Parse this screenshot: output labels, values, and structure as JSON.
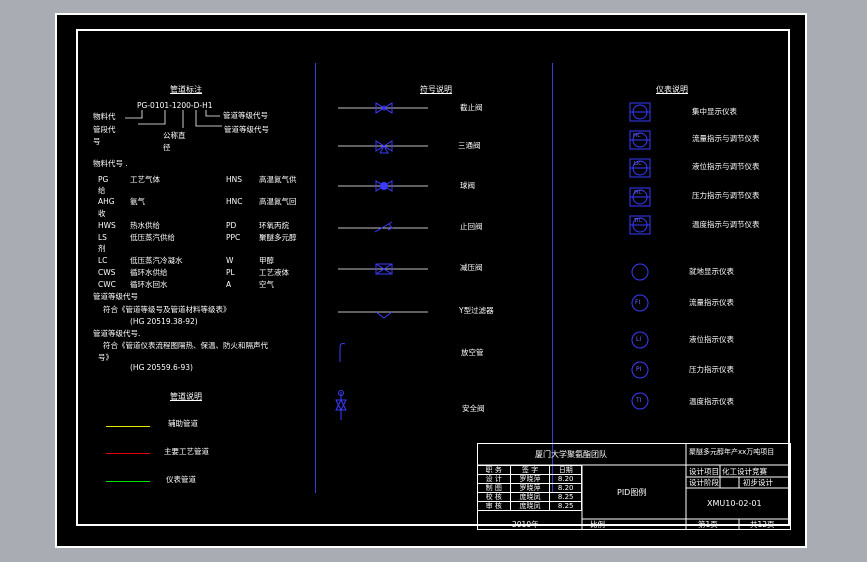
{
  "pipe_std": {
    "title": "管道标注",
    "code": "PG-0101-1200-D-H1",
    "lbl_material": "物料代",
    "lbl_grade": "管道等级代号",
    "lbl_segment": "管段代",
    "lbl_segment2": "号",
    "lbl_nominal": "公称直",
    "lbl_nominal2": "径",
    "lbl_grade2": "管道等级代号",
    "lbl_matcode": "物料代号 ."
  },
  "materials": [
    {
      "code": "PG",
      "name": "工艺气体"
    },
    {
      "code": "AHG",
      "name": "氨气"
    },
    {
      "code": "HWS",
      "name": "热水供给"
    },
    {
      "code": "LS",
      "name": "低压蒸汽供给"
    },
    {
      "code": "LC",
      "name": "低压蒸汽冷凝水"
    },
    {
      "code": "CWS",
      "name": "循环水供给"
    },
    {
      "code": "CWC",
      "name": "循环水回水"
    }
  ],
  "materials_right": [
    {
      "code": "HNS",
      "name": "高温氮气供"
    },
    {
      "code": "HNC",
      "name": "高温氮气回"
    },
    {
      "code": "PD",
      "name": "环氧丙烷"
    },
    {
      "code": "PPC",
      "name": "聚醚多元醇"
    },
    {
      "code": "W",
      "name": "甲醇"
    },
    {
      "code": "PL",
      "name": "工艺液体"
    },
    {
      "code": "A",
      "name": "空气"
    }
  ],
  "material_frag": {
    "a": "给",
    "b": "收",
    "c": "剂"
  },
  "grade_notes": {
    "line1": "管道等级代号",
    "line2": "符合《管道等级号及管道材料等级表》",
    "line3": "(HG 20519.38-92)",
    "line4": "管道等级代号.",
    "line5": "符合《管道仪表流程图隔热、保温、防火和隔声代",
    "line6": "号》",
    "line7": "(HG 20559.6-93)"
  },
  "pipe_legend": {
    "title": "管道说明",
    "items": [
      {
        "label": "辅助管道",
        "color": "#e8e800"
      },
      {
        "label": "主要工艺管道",
        "color": "#e00000"
      },
      {
        "label": "仪表管道",
        "color": "#00e000"
      }
    ]
  },
  "symbols": {
    "title": "符号说明",
    "items": [
      "截止阀",
      "三通阀",
      "球阀",
      "止回阀",
      "减压阀",
      "Y型过滤器",
      "放空管",
      "安全阀"
    ]
  },
  "instruments": {
    "title": "仪表说明",
    "items": [
      "集中显示仪表",
      "流量指示与调节仪表",
      "液位指示与调节仪表",
      "压力指示与调节仪表",
      "温度指示与调节仪表",
      "就地显示仪表",
      "流量指示仪表",
      "液位指示仪表",
      "压力指示仪表",
      "温度指示仪表"
    ],
    "tags": [
      "",
      "FIC",
      "LIC",
      "PIC",
      "TIC",
      "",
      "FI",
      "LI",
      "PI",
      "TI"
    ]
  },
  "title_block": {
    "team": "厦门大学聚氨酯团队",
    "project": "聚醚多元醇年产xx万吨项目",
    "headers": [
      "职 务",
      "签 字",
      "日期"
    ],
    "rows": [
      [
        "设 计",
        "罗晓萍",
        "8.20"
      ],
      [
        "制 图",
        "罗晓萍",
        "8.20"
      ],
      [
        "校 核",
        "庞晓凤",
        "8.25"
      ],
      [
        "审 核",
        "庞晓凤",
        "8.25"
      ]
    ],
    "year": "2010年",
    "scale_label": "比例",
    "drawing_name": "PID图例",
    "design_item_label": "设计项目",
    "design_item": "化工设计竞赛",
    "design_phase_label": "设计阶段",
    "design_phase": "初步设计",
    "drawing_no": "XMU10-02-01",
    "sheet": "第1页",
    "total": "共12页"
  }
}
